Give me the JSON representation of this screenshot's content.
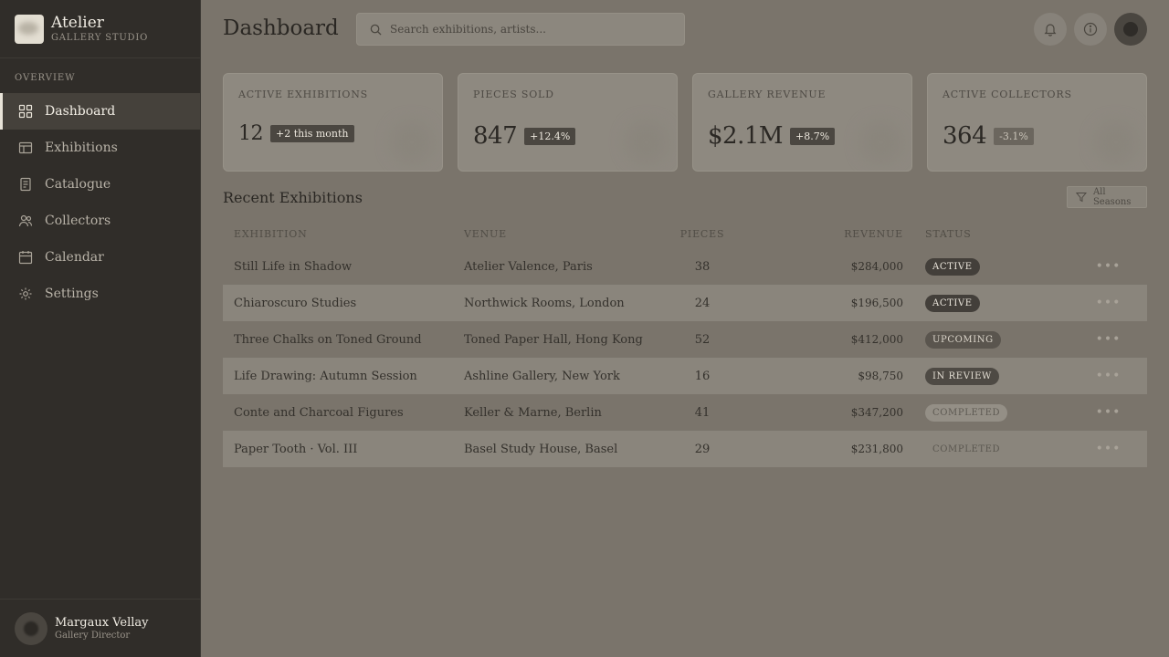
{
  "brand": {
    "name": "Atelier",
    "subtitle": "GALLERY STUDIO"
  },
  "sidebar": {
    "section": "OVERVIEW",
    "items": [
      {
        "label": "Dashboard",
        "icon": "grid-icon",
        "active": true
      },
      {
        "label": "Exhibitions",
        "icon": "layout-icon"
      },
      {
        "label": "Catalogue",
        "icon": "book-icon"
      },
      {
        "label": "Collectors",
        "icon": "users-icon"
      },
      {
        "label": "Calendar",
        "icon": "calendar-icon"
      },
      {
        "label": "Settings",
        "icon": "gear-icon"
      }
    ]
  },
  "user": {
    "name": "Margaux Vellay",
    "role": "Gallery Director"
  },
  "header": {
    "title": "Dashboard",
    "search_placeholder": "Search exhibitions, artists..."
  },
  "stats": [
    {
      "label": "ACTIVE EXHIBITIONS",
      "value": "12",
      "badge": "+2 this month"
    },
    {
      "label": "PIECES SOLD",
      "value": "847",
      "badge": "+12.4%"
    },
    {
      "label": "GALLERY REVENUE",
      "value": "$2.1M",
      "badge": "+8.7%"
    },
    {
      "label": "ACTIVE COLLECTORS",
      "value": "364",
      "badge": "-3.1%"
    }
  ],
  "recent": {
    "title": "Recent Exhibitions",
    "filter_label": "All Seasons",
    "columns": {
      "exhibition": "EXHIBITION",
      "venue": "VENUE",
      "pieces": "PIECES",
      "revenue": "REVENUE",
      "status": "STATUS"
    },
    "rows": [
      {
        "exhibition": "Still Life in Shadow",
        "venue": "Atelier Valence, Paris",
        "pieces": "38",
        "revenue": "$284,000",
        "status": "ACTIVE"
      },
      {
        "exhibition": "Chiaroscuro Studies",
        "venue": "Northwick Rooms, London",
        "pieces": "24",
        "revenue": "$196,500",
        "status": "ACTIVE"
      },
      {
        "exhibition": "Three Chalks on Toned Ground",
        "venue": "Toned Paper Hall, Hong Kong",
        "pieces": "52",
        "revenue": "$412,000",
        "status": "UPCOMING"
      },
      {
        "exhibition": "Life Drawing: Autumn Session",
        "venue": "Ashline Gallery, New York",
        "pieces": "16",
        "revenue": "$98,750",
        "status": "IN REVIEW"
      },
      {
        "exhibition": "Conte and Charcoal Figures",
        "venue": "Keller & Marne, Berlin",
        "pieces": "41",
        "revenue": "$347,200",
        "status": "COMPLETED"
      },
      {
        "exhibition": "Paper Tooth · Vol. III",
        "venue": "Basel Study House, Basel",
        "pieces": "29",
        "revenue": "$231,800",
        "status": "COMPLETED"
      }
    ]
  }
}
